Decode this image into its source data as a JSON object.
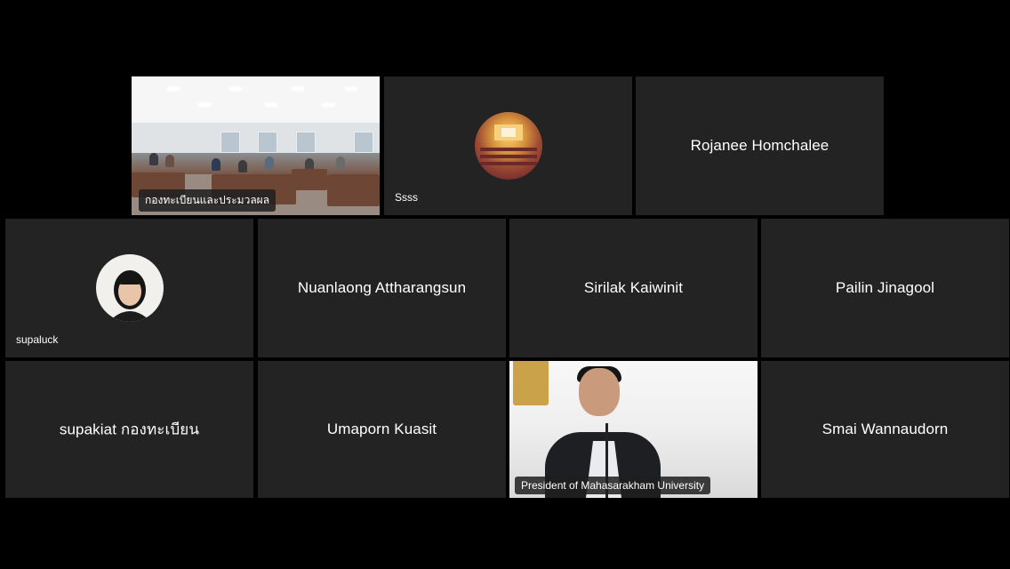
{
  "participants": {
    "row1": [
      {
        "name": "กองทะเบียนและประมวลผล",
        "type": "video-classroom"
      },
      {
        "name": "Ssss",
        "type": "avatar-auditorium"
      },
      {
        "name": "Rojanee Homchalee",
        "type": "name-only"
      }
    ],
    "row2": [
      {
        "name": "supaluck",
        "type": "avatar-person"
      },
      {
        "name": "Nuanlaong Attharangsun",
        "type": "name-only"
      },
      {
        "name": "Sirilak Kaiwinit",
        "type": "name-only"
      },
      {
        "name": "Pailin Jinagool",
        "type": "name-only"
      }
    ],
    "row3": [
      {
        "name": "supakiat กองทะเบียน",
        "type": "name-only"
      },
      {
        "name": "Umaporn Kuasit",
        "type": "name-only"
      },
      {
        "name": "President of Mahasarakham University",
        "type": "video-president"
      },
      {
        "name": "Smai Wannaudorn",
        "type": "name-only"
      }
    ]
  },
  "colors": {
    "background": "#000000",
    "tile": "#232323",
    "text": "#ffffff"
  }
}
